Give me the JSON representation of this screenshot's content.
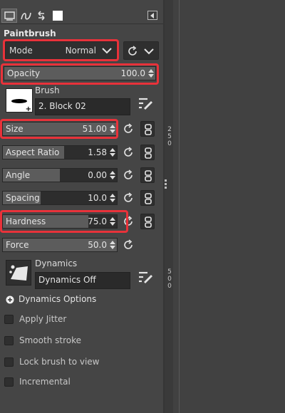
{
  "tabs": [
    {
      "name": "tool-options-tab-icon",
      "active": true
    },
    {
      "name": "paths-tab-icon",
      "active": false
    },
    {
      "name": "undo-history-tab-icon",
      "active": false
    },
    {
      "name": "images-tab-icon",
      "active": false
    }
  ],
  "panel_title": "Paintbrush",
  "mode": {
    "label": "Mode",
    "value": "Normal"
  },
  "opacity": {
    "label": "Opacity",
    "value": "100.0",
    "fraction": 1.0
  },
  "brush": {
    "label": "Brush",
    "value": "2. Block 02"
  },
  "sliders": [
    {
      "key": "size",
      "label": "Size",
      "value": "51.00",
      "fraction": 1.0
    },
    {
      "key": "aspect",
      "label": "Aspect Ratio",
      "value": "1.58",
      "fraction": 0.54
    },
    {
      "key": "angle",
      "label": "Angle",
      "value": "0.00",
      "fraction": 0.5
    },
    {
      "key": "spacing",
      "label": "Spacing",
      "value": "10.0",
      "fraction": 0.33
    },
    {
      "key": "hardness",
      "label": "Hardness",
      "value": "75.0",
      "fraction": 0.75
    },
    {
      "key": "force",
      "label": "Force",
      "value": "50.0",
      "fraction": 1.0
    }
  ],
  "dynamics": {
    "label": "Dynamics",
    "value": "Dynamics Off"
  },
  "dynamics_options_label": "Dynamics Options",
  "checkboxes": [
    {
      "label": "Apply Jitter",
      "checked": false
    },
    {
      "label": "Smooth stroke",
      "checked": false
    },
    {
      "label": "Lock brush to view",
      "checked": false
    },
    {
      "label": "Incremental",
      "checked": false
    }
  ],
  "ruler_marks": [
    "2",
    "5",
    "0",
    "5",
    "0",
    "0"
  ],
  "colors": {
    "highlight": "#e8323a",
    "panel_bg": "#454545"
  }
}
